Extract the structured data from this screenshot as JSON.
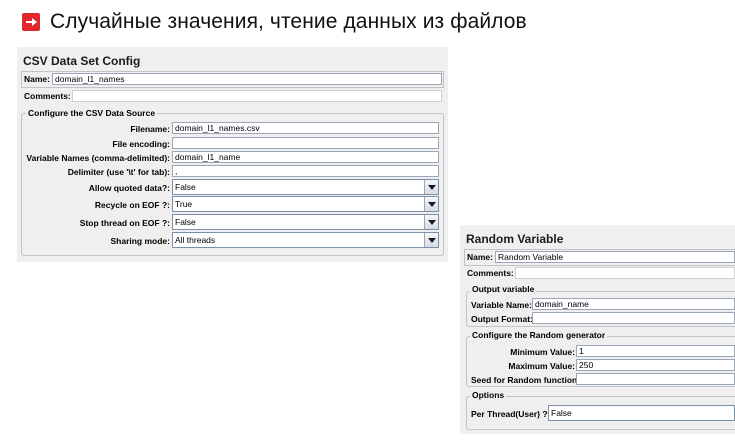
{
  "slide": {
    "title": "Случайные значения, чтение данных из файлов",
    "icon": "arrow-right-box-icon",
    "accent": "#e0282e"
  },
  "csv": {
    "title": "CSV Data Set Config",
    "name_label": "Name:",
    "name_value": "domain_l1_names",
    "comments_label": "Comments:",
    "comments_value": "",
    "group_title": "Configure the CSV Data Source",
    "filename_label": "Filename:",
    "filename_value": "domain_l1_names.csv",
    "encoding_label": "File encoding:",
    "encoding_value": "",
    "varnames_label": "Variable Names (comma-delimited):",
    "varnames_value": "domain_l1_name",
    "delimiter_label": "Delimiter (use '\\t' for tab):",
    "delimiter_value": ",",
    "quoted_label": "Allow quoted data?:",
    "quoted_value": "False",
    "recycle_label": "Recycle on EOF ?:",
    "recycle_value": "True",
    "stop_label": "Stop thread on EOF ?:",
    "stop_value": "False",
    "sharing_label": "Sharing mode:",
    "sharing_value": "All threads"
  },
  "random": {
    "title": "Random Variable",
    "name_label": "Name:",
    "name_value": "Random Variable",
    "comments_label": "Comments:",
    "comments_value": "",
    "output_group": "Output variable",
    "varname_label": "Variable Name:",
    "varname_value": "domain_name",
    "format_label": "Output Format:",
    "format_value": "",
    "gen_group": "Configure the Random generator",
    "min_label": "Minimum Value:",
    "min_value": "1",
    "max_label": "Maximum Value:",
    "max_value": "250",
    "seed_label": "Seed for Random function:",
    "seed_value": "",
    "options_group": "Options",
    "perthread_label": "Per Thread(User) ?:",
    "perthread_value": "False"
  }
}
